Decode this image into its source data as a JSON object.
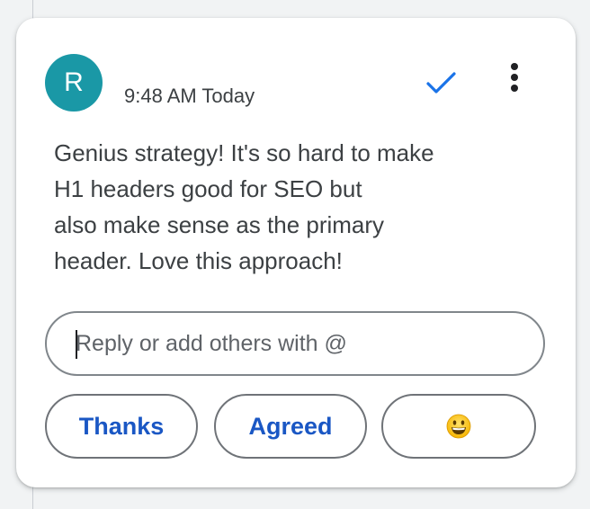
{
  "comment": {
    "author_initial": "R",
    "timestamp": "9:48 AM Today",
    "text": "Genius strategy! It's so hard to make\nH1 headers good for SEO but\nalso make sense as the primary\nheader. Love this approach!"
  },
  "actions": {
    "resolve_icon": "checkmark-icon",
    "more_icon": "more-vert-icon"
  },
  "reply": {
    "placeholder": "Reply or add others with @",
    "value": ""
  },
  "quick_replies": {
    "thanks_label": "Thanks",
    "agreed_label": "Agreed",
    "emoji_icon": "grinning-face-emoji"
  },
  "colors": {
    "avatar_bg": "#1a98a6",
    "accent_blue": "#1a57c4",
    "check_blue": "#1a73e8",
    "text_primary": "#3c4043"
  }
}
